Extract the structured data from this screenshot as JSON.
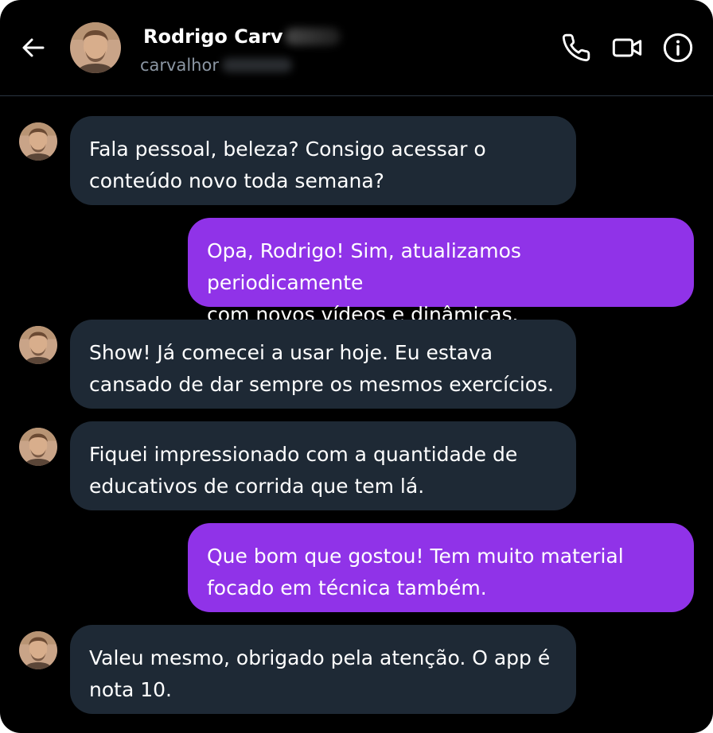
{
  "header": {
    "contact_name": "Rodrigo Carv",
    "contact_handle": "carvalhor",
    "back_icon": "arrow-left-icon",
    "phone_icon": "phone-icon",
    "video_icon": "video-camera-icon",
    "info_icon": "info-circle-icon"
  },
  "colors": {
    "background": "#000000",
    "incoming_bubble": "#1e2935",
    "outgoing_bubble": "#9033e8",
    "text": "#ffffff",
    "handle_text": "#8b96a3"
  },
  "messages": [
    {
      "direction": "in",
      "text": "Fala pessoal, beleza? Consigo acessar o\nconteúdo novo toda semana?"
    },
    {
      "direction": "out",
      "text": "Opa, Rodrigo! Sim, atualizamos periodicamente\ncom novos vídeos e dinâmicas."
    },
    {
      "direction": "in",
      "text": "Show! Já comecei a usar hoje. Eu estava\ncansado de dar sempre os mesmos exercícios."
    },
    {
      "direction": "in",
      "text": "Fiquei impressionado com a quantidade de\neducativos de corrida que tem lá."
    },
    {
      "direction": "out",
      "text": "Que bom que gostou! Tem muito material\nfocado em técnica também."
    },
    {
      "direction": "in",
      "text": "Valeu mesmo, obrigado pela atenção. O app é\nnota 10."
    }
  ]
}
